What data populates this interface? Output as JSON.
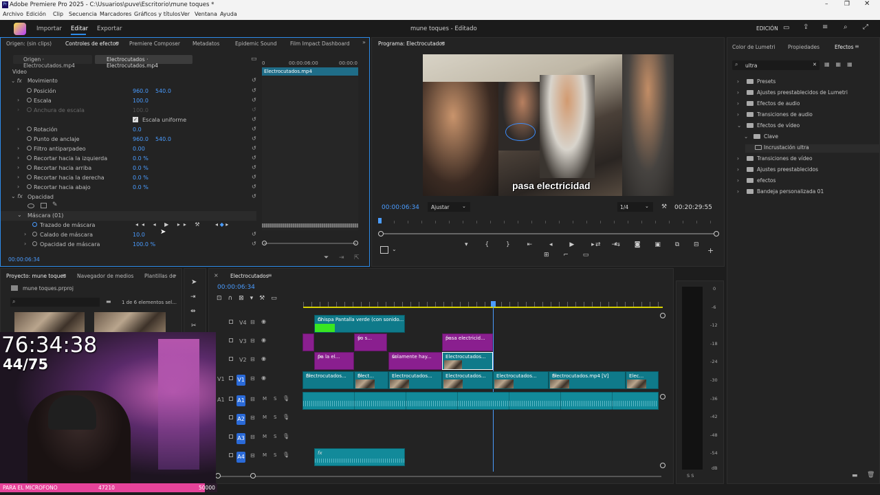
{
  "window": {
    "title": "Adobe Premiere Pro 2025 - C:\\Usuarios\\puve\\Escritorio\\mune toques *"
  },
  "menu": [
    "Archivo",
    "Edición",
    "Clip",
    "Secuencia",
    "Marcadores",
    "Gráficos y títulos",
    "Ver",
    "Ventana",
    "Ayuda"
  ],
  "appbar": {
    "tabs": [
      "Importar",
      "Editar",
      "Exportar"
    ],
    "project_title": "mune toques - Editado",
    "workspace": "EDICIÓN"
  },
  "effect_controls": {
    "tabs": [
      "Origen: (sin clips)",
      "Controles de efectos",
      "Premiere Composer",
      "Metadatos",
      "Epidemic Sound",
      "Film Impact Dashboard"
    ],
    "source_tab": "Origen · Electrocutados.mp4",
    "seq_tab": "Electrocutados · Electrocutados.mp4",
    "ruler": [
      "0",
      "00:00:06:00",
      "00:00:0"
    ],
    "clip_name": "Electrocutados.mp4",
    "section": "Video",
    "motion": "Movimiento",
    "rows": [
      {
        "label": "Posición",
        "v1": "960.0",
        "v2": "540.0"
      },
      {
        "label": "Escala",
        "v1": "100.0",
        "v2": ""
      },
      {
        "label": "Anchura de escala",
        "v1": "100.0",
        "v2": ""
      },
      {
        "label": "Escala uniforme",
        "v1": "",
        "v2": ""
      },
      {
        "label": "Rotación",
        "v1": "0.0",
        "v2": ""
      },
      {
        "label": "Punto de anclaje",
        "v1": "960.0",
        "v2": "540.0"
      },
      {
        "label": "Filtro antiparpadeo",
        "v1": "0.00",
        "v2": ""
      },
      {
        "label": "Recortar hacia la izquierda",
        "v1": "0.0 %",
        "v2": ""
      },
      {
        "label": "Recortar hacia arriba",
        "v1": "0.0 %",
        "v2": ""
      },
      {
        "label": "Recortar hacia la derecha",
        "v1": "0.0 %",
        "v2": ""
      },
      {
        "label": "Recortar hacia abajo",
        "v1": "0.0 %",
        "v2": ""
      },
      {
        "label": "Opacidad",
        "v1": "",
        "v2": ""
      },
      {
        "label": "Máscara (01)",
        "v1": "",
        "v2": ""
      },
      {
        "label": "Trazado de máscara",
        "v1": "",
        "v2": ""
      },
      {
        "label": "Calado de máscara",
        "v1": "10.0",
        "v2": ""
      },
      {
        "label": "Opacidad de máscara",
        "v1": "100.0 %",
        "v2": ""
      }
    ],
    "timecode": "00:00:06:34"
  },
  "program": {
    "title": "Programa: Electrocutados",
    "caption": "pasa electricidad",
    "timecode": "00:00:06:34",
    "fit": "Ajustar",
    "quality": "1/4",
    "duration": "00:20:29:55"
  },
  "effects_panel": {
    "tabs": [
      "Color de Lumetri",
      "Propiedades",
      "Efectos"
    ],
    "search": "ultra",
    "items": [
      {
        "label": "Presets",
        "indent": 0,
        "open": false
      },
      {
        "label": "Ajustes preestablecidos de Lumetri",
        "indent": 0,
        "open": false
      },
      {
        "label": "Efectos de audio",
        "indent": 0,
        "open": false
      },
      {
        "label": "Transiciones de audio",
        "indent": 0,
        "open": false
      },
      {
        "label": "Efectos de vídeo",
        "indent": 0,
        "open": true
      },
      {
        "label": "Clave",
        "indent": 1,
        "open": true
      },
      {
        "label": "Incrustación ultra",
        "indent": 2,
        "open": false
      },
      {
        "label": "Transiciones de vídeo",
        "indent": 0,
        "open": false
      },
      {
        "label": "Ajustes preestablecidos",
        "indent": 0,
        "open": false
      },
      {
        "label": "efectos",
        "indent": 0,
        "open": false
      },
      {
        "label": "Bandeja personalizada 01",
        "indent": 0,
        "open": false
      }
    ]
  },
  "project": {
    "tabs": [
      "Proyecto: mune toques",
      "Navegador de medios",
      "Plantillas de"
    ],
    "file": "mune toques.prproj",
    "count": "1 de 6 elementos sel..."
  },
  "timeline": {
    "tab": "Electrocutados",
    "timecode": "00:00:06:34",
    "tracks": [
      "V4",
      "V3",
      "V2",
      "V1",
      "A1",
      "A2",
      "A3",
      "A4"
    ],
    "clips": {
      "v4a": "Chispa Pantalla verde (con sonido...",
      "v3a": "yo s...",
      "v3b": "pasa electricid...",
      "v2a": "pa la el...",
      "v2b": "solamente hay...",
      "v2c": "Electrocutados...",
      "v1a": "Electrocutados...",
      "v1b": "Elect...",
      "v1c": "Electrocutados...",
      "v1d": "Electrocutados...",
      "v1e": "Electrocutados...",
      "v1f": "Electrocutados.mp4 [V]",
      "v1g": "Elec..."
    },
    "fx": "fx",
    "meter": [
      "0",
      "-6",
      "-12",
      "-18",
      "-24",
      "-30",
      "-36",
      "-42",
      "-48",
      "-54",
      "dB"
    ],
    "meter_ss": "S   S"
  },
  "overlay": {
    "timer": "76:34:38",
    "count": "44/75",
    "goal_label": "PARA EL MICROFONO",
    "goal_current": "47210",
    "goal_target": "50000",
    "goal_progress": 0.944
  }
}
